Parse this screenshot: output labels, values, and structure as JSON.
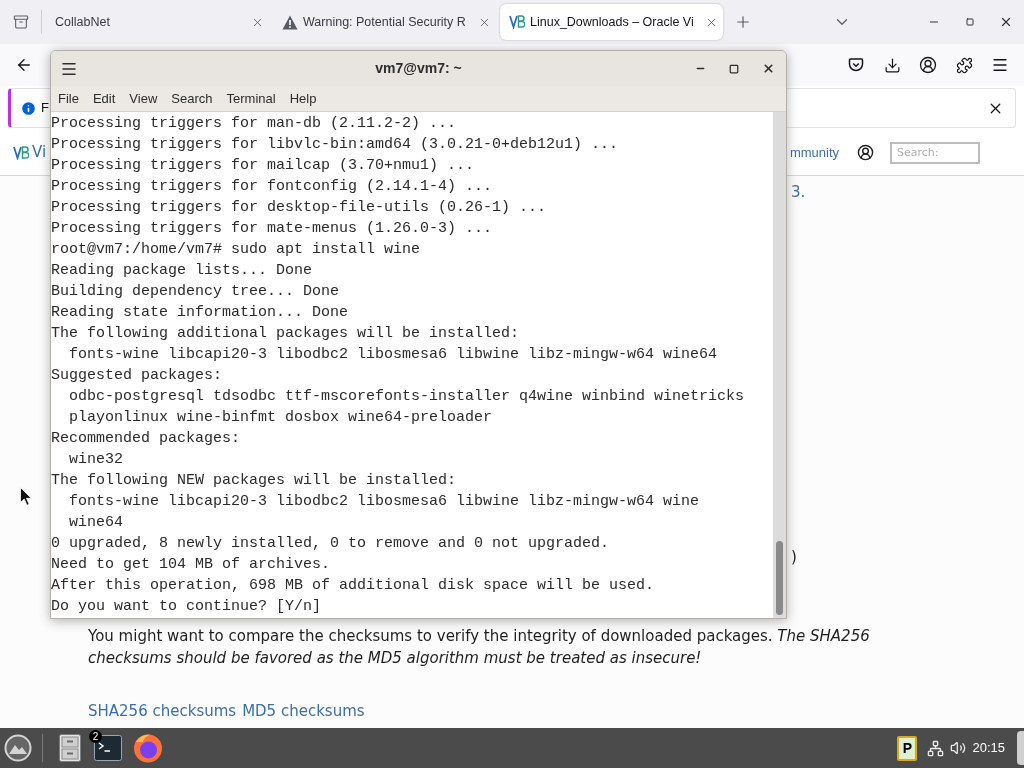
{
  "browser": {
    "tabs": [
      {
        "kind": "plain",
        "title": "CollabNet",
        "selected": false
      },
      {
        "kind": "warning",
        "title": "Warning: Potential Security R",
        "selected": false
      },
      {
        "kind": "site",
        "title": "Linux_Downloads – Oracle Vi",
        "selected": true
      }
    ],
    "notification": {
      "text": "F"
    },
    "site_header": {
      "logo_text": "Vi",
      "nav_link": "mmunity",
      "search": {
        "placeholder": "Search:"
      }
    },
    "content": {
      "fragments": [
        "3.",
        ")"
      ],
      "paragraph": "You might want to compare the checksums to verify the integrity of downloaded packages. *The SHA256 checksums should be favored as the MD5 algorithm must be treated as insecure!*",
      "links": [
        "SHA256 checksums",
        "MD5 checksums"
      ]
    }
  },
  "terminal": {
    "title": "vm7@vm7: ~",
    "menu": [
      "File",
      "Edit",
      "View",
      "Search",
      "Terminal",
      "Help"
    ],
    "lines": [
      "Processing triggers for man-db (2.11.2-2) ...",
      "Processing triggers for libvlc-bin:amd64 (3.0.21-0+deb12u1) ...",
      "Processing triggers for mailcap (3.70+nmu1) ...",
      "Processing triggers for fontconfig (2.14.1-4) ...",
      "Processing triggers for desktop-file-utils (0.26-1) ...",
      "Processing triggers for mate-menus (1.26.0-3) ...",
      "root@vm7:/home/vm7# sudo apt install wine",
      "Reading package lists... Done",
      "Building dependency tree... Done",
      "Reading state information... Done",
      "The following additional packages will be installed:",
      "  fonts-wine libcapi20-3 libodbc2 libosmesa6 libwine libz-mingw-w64 wine64",
      "Suggested packages:",
      "  odbc-postgresql tdsodbc ttf-mscorefonts-installer q4wine winbind winetricks",
      "  playonlinux wine-binfmt dosbox wine64-preloader",
      "Recommended packages:",
      "  wine32",
      "The following NEW packages will be installed:",
      "  fonts-wine libcapi20-3 libodbc2 libosmesa6 libwine libz-mingw-w64 wine",
      "  wine64",
      "0 upgraded, 8 newly installed, 0 to remove and 0 not upgraded.",
      "Need to get 104 MB of archives.",
      "After this operation, 698 MB of additional disk space will be used.",
      "Do you want to continue? [Y/n]"
    ]
  },
  "taskbar": {
    "apps": [
      {
        "kind": "files"
      },
      {
        "kind": "terminal",
        "badge": "2"
      },
      {
        "kind": "web-browser"
      }
    ],
    "tray": {
      "clipboard_label": "P"
    },
    "clock": "20:15"
  }
}
